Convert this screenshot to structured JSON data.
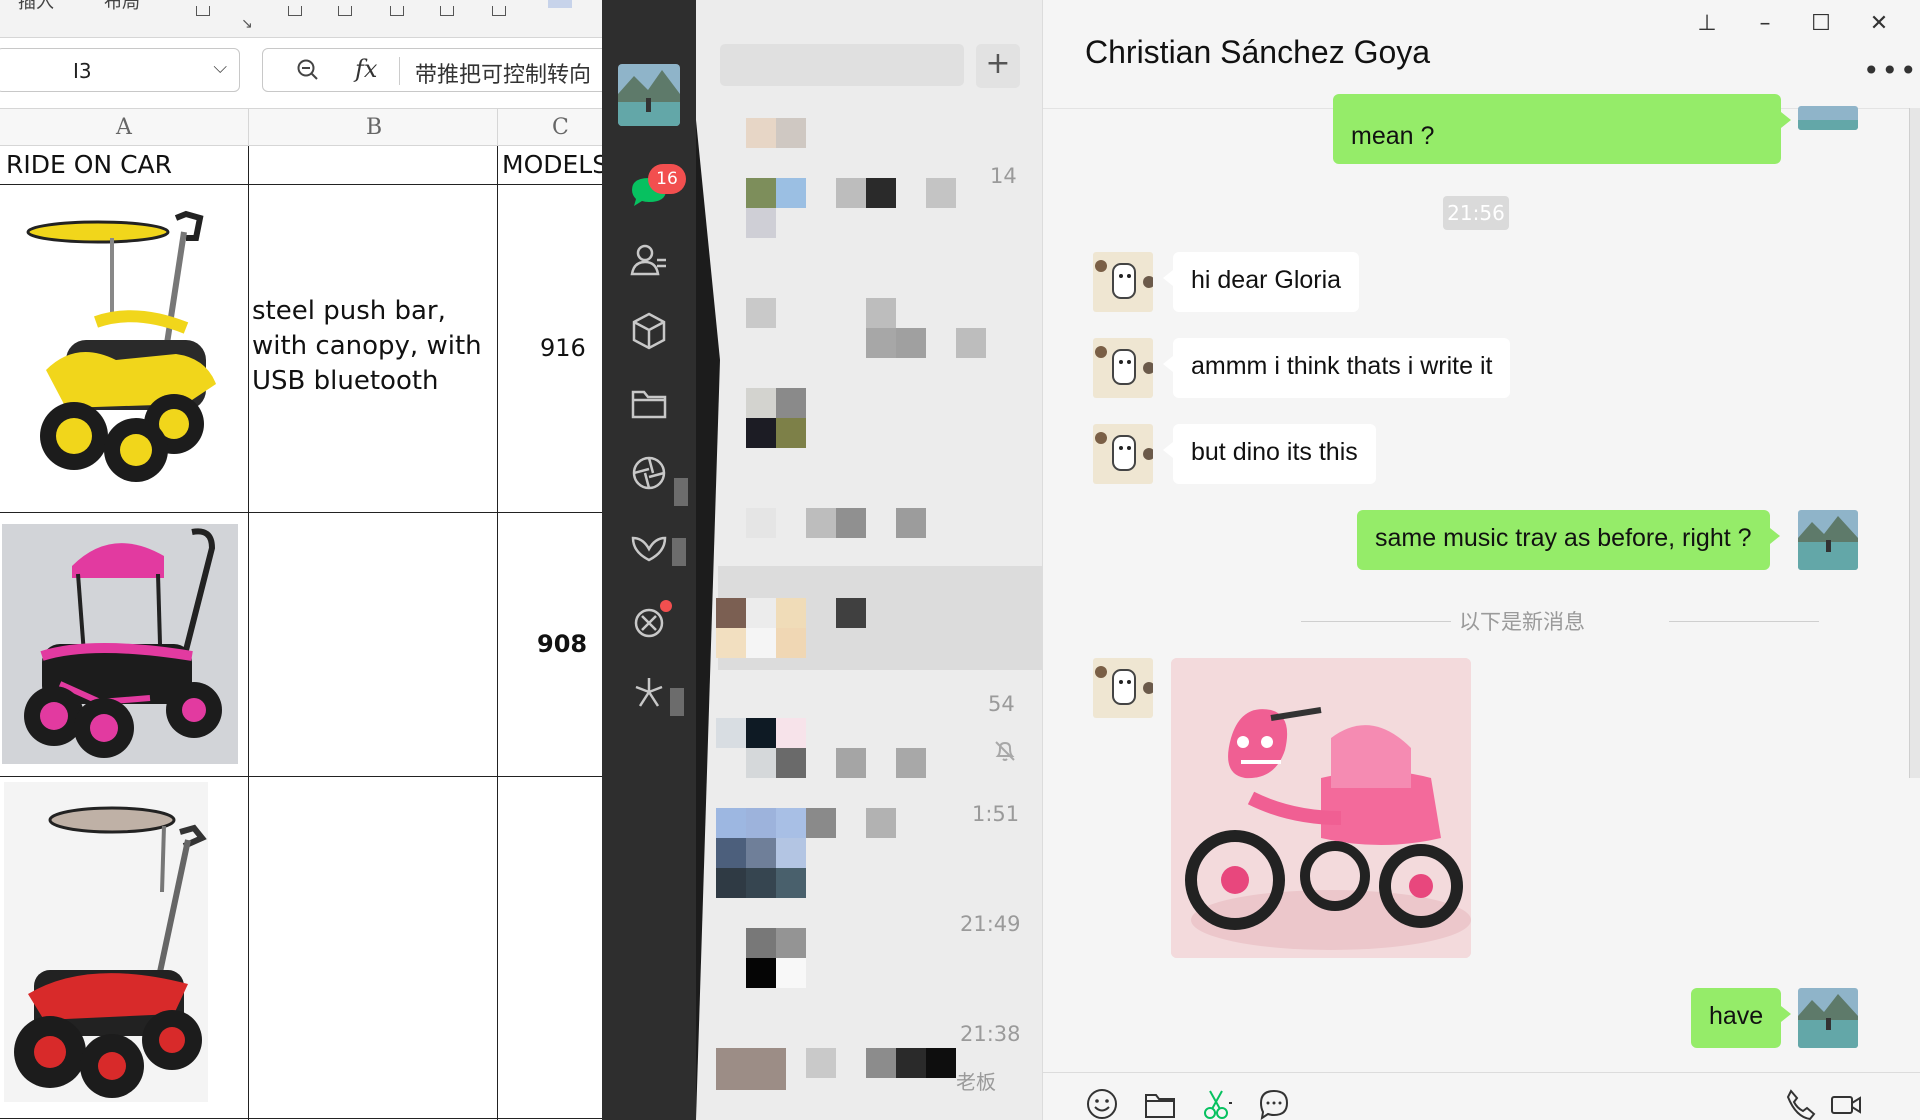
{
  "excel": {
    "ribbon_fragments": [
      "插入",
      "布局"
    ],
    "name_box": "I3",
    "formula_text": "带推把可控制转向",
    "columns": [
      "A",
      "B",
      "C"
    ],
    "header_row": {
      "col_a": "RIDE ON CAR",
      "col_c": "MODELS"
    },
    "rows": [
      {
        "description": "steel push bar, with canopy, with USB bluetooth",
        "model": "916",
        "car_colors": [
          "#f1d61b",
          "#222222"
        ]
      },
      {
        "description": "",
        "model": "908",
        "car_colors": [
          "#e23aa0",
          "#1c1c1c"
        ]
      },
      {
        "description": "",
        "model": "",
        "car_colors": [
          "#d82a2a",
          "#222222"
        ]
      }
    ]
  },
  "wechat": {
    "nav": {
      "unread_badge": "16",
      "icons": [
        "chat-icon",
        "contacts-icon",
        "cube-icon",
        "folder-icon",
        "moments-icon",
        "channels-icon",
        "mini-program-icon",
        "search-spark-icon"
      ]
    },
    "chat_list": {
      "times": [
        "14",
        "54",
        "1:51",
        "21:49",
        "21:38"
      ],
      "snippet": "老板"
    },
    "chat": {
      "contact_name": "Christian Sánchez Goya",
      "messages": [
        {
          "from": "me",
          "text": "mean ?"
        },
        {
          "type": "time",
          "text": "21:56"
        },
        {
          "from": "them",
          "text": "hi dear Gloria"
        },
        {
          "from": "them",
          "text": "ammm i think thats i write it"
        },
        {
          "from": "them",
          "text": "but dino its this"
        },
        {
          "from": "me",
          "text": "same music tray as before, right ?"
        },
        {
          "type": "divider",
          "text": "以下是新消息"
        },
        {
          "from": "them",
          "type": "image"
        },
        {
          "from": "me",
          "text": "have"
        }
      ],
      "toolbar": [
        "emoji-icon",
        "folder-icon",
        "scissors-icon",
        "chat-bubble-icon",
        "phone-icon",
        "video-icon"
      ]
    },
    "colors": {
      "green_bubble": "#95ec69",
      "nav_bg": "#2e2e2e",
      "badge": "#f24f4f"
    }
  }
}
